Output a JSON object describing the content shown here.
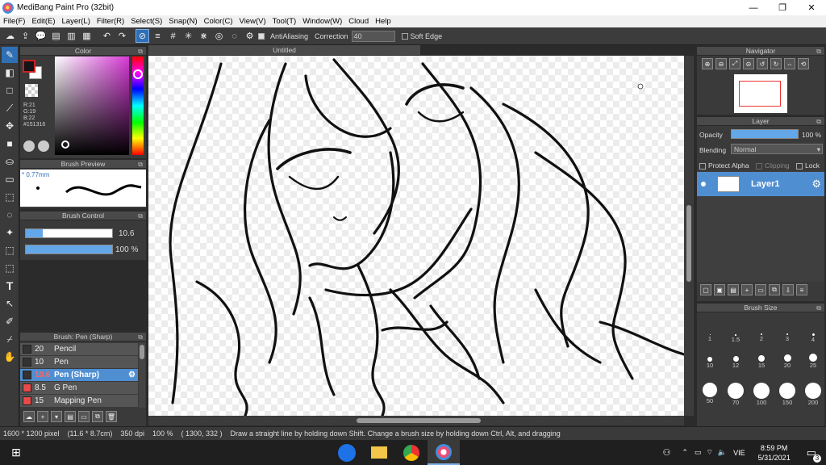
{
  "window": {
    "title": "MediBang Paint Pro (32bit)",
    "minimize": "—",
    "restore": "❐",
    "close": "✕"
  },
  "menu": [
    "File(F)",
    "Edit(E)",
    "Layer(L)",
    "Filter(R)",
    "Select(S)",
    "Snap(N)",
    "Color(C)",
    "View(V)",
    "Tool(T)",
    "Window(W)",
    "Cloud",
    "Help"
  ],
  "toolbar": {
    "antialiasing_label": "AntiAliasing",
    "correction_label": "Correction",
    "correction_value": "40",
    "soft_edge_label": "Soft Edge"
  },
  "color_panel": {
    "title": "Color",
    "r": "R:21",
    "g": "G:19",
    "b": "B:22",
    "hex": "#151316",
    "current_color": "#151316"
  },
  "brush_preview": {
    "title": "Brush Preview",
    "size": "* 0.77mm"
  },
  "brush_control": {
    "title": "Brush Control",
    "size_value": "10.6",
    "opacity_value": "100 %",
    "size_fraction": 0.2,
    "opacity_fraction": 1.0
  },
  "brush_list": {
    "title": "Brush: Pen (Sharp)",
    "items": [
      {
        "size": "20",
        "name": "Pencil",
        "color": "#333333"
      },
      {
        "size": "10",
        "name": "Pen",
        "color": "#333333"
      },
      {
        "size": "10.6",
        "name": "Pen (Sharp)",
        "color": "#333333",
        "selected": true
      },
      {
        "size": "8.5",
        "name": "G Pen",
        "color": "#e84a4a"
      },
      {
        "size": "15",
        "name": "Mapping Pen",
        "color": "#e84a4a"
      }
    ]
  },
  "document": {
    "tab": "Untitled"
  },
  "navigator": {
    "title": "Navigator"
  },
  "layer_panel": {
    "title": "Layer",
    "opacity_label": "Opacity",
    "opacity_value": "100 %",
    "opacity_fraction": 1.0,
    "blending_label": "Blending",
    "blending_value": "Normal",
    "protect_alpha": "Protect Alpha",
    "clipping": "Clipping",
    "lock": "Lock",
    "layers": [
      {
        "name": "Layer1"
      }
    ]
  },
  "brush_size_panel": {
    "title": "Brush Size",
    "sizes": [
      "1",
      "1.5",
      "2",
      "3",
      "4",
      "10",
      "12",
      "15",
      "20",
      "25",
      "50",
      "70",
      "100",
      "150",
      "200"
    ]
  },
  "status": {
    "dimensions": "1600 * 1200 pixel",
    "physical": "(11.6 * 8.7cm)",
    "dpi": "350 dpi",
    "zoom": "100 %",
    "cursor": "( 1300, 332 )",
    "hint": "Draw a straight line by holding down Shift. Change a brush size by holding down Ctrl, Alt, and dragging"
  },
  "taskbar": {
    "time": "8:59 PM",
    "date": "5/31/2021",
    "lang": "VIE",
    "notifications": "3"
  }
}
